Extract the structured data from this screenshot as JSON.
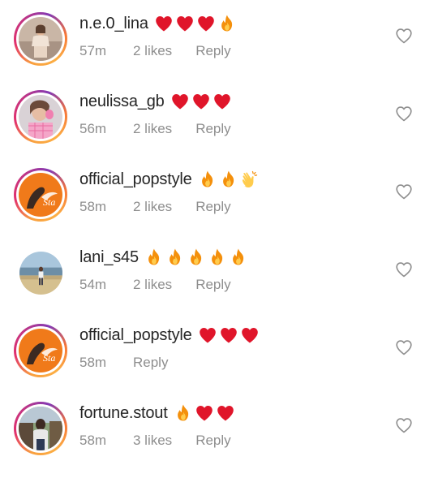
{
  "comments": [
    {
      "username": "n.e.0_lina",
      "emojis": [
        "heart",
        "heart",
        "heart",
        "fire"
      ],
      "time": "57m",
      "likes": "2 likes",
      "reply": "Reply",
      "avatar": "woman-portrait",
      "story_ring": true
    },
    {
      "username": "neulissa_gb",
      "emojis": [
        "heart",
        "heart",
        "heart"
      ],
      "time": "56m",
      "likes": "2 likes",
      "reply": "Reply",
      "avatar": "selfie-portrait",
      "story_ring": true
    },
    {
      "username": "official_popstyle",
      "emojis": [
        "fire",
        "fire",
        "clap"
      ],
      "time": "58m",
      "likes": "2 likes",
      "reply": "Reply",
      "avatar": "popstyle-logo",
      "story_ring": true
    },
    {
      "username": "lani_s45",
      "emojis": [
        "fire",
        "fire",
        "fire",
        "fire",
        "fire"
      ],
      "time": "54m",
      "likes": "2 likes",
      "reply": "Reply",
      "avatar": "beach-person",
      "story_ring": false
    },
    {
      "username": "official_popstyle",
      "emojis": [
        "heart",
        "heart",
        "heart"
      ],
      "time": "58m",
      "likes": "",
      "reply": "Reply",
      "avatar": "popstyle-logo",
      "story_ring": true
    },
    {
      "username": "fortune.stout",
      "emojis": [
        "fire",
        "heart",
        "heart"
      ],
      "time": "58m",
      "likes": "3 likes",
      "reply": "Reply",
      "avatar": "man-portrait",
      "story_ring": true
    }
  ],
  "colors": {
    "username": "#262626",
    "meta": "#8e8e8e",
    "heart_emoji": "#e0152a",
    "like_outline": "#8e8e8e"
  },
  "icons": {
    "like": "heart-outline-icon",
    "heart": "red-heart-emoji",
    "fire": "fire-emoji",
    "clap": "clapping-hands-emoji"
  }
}
